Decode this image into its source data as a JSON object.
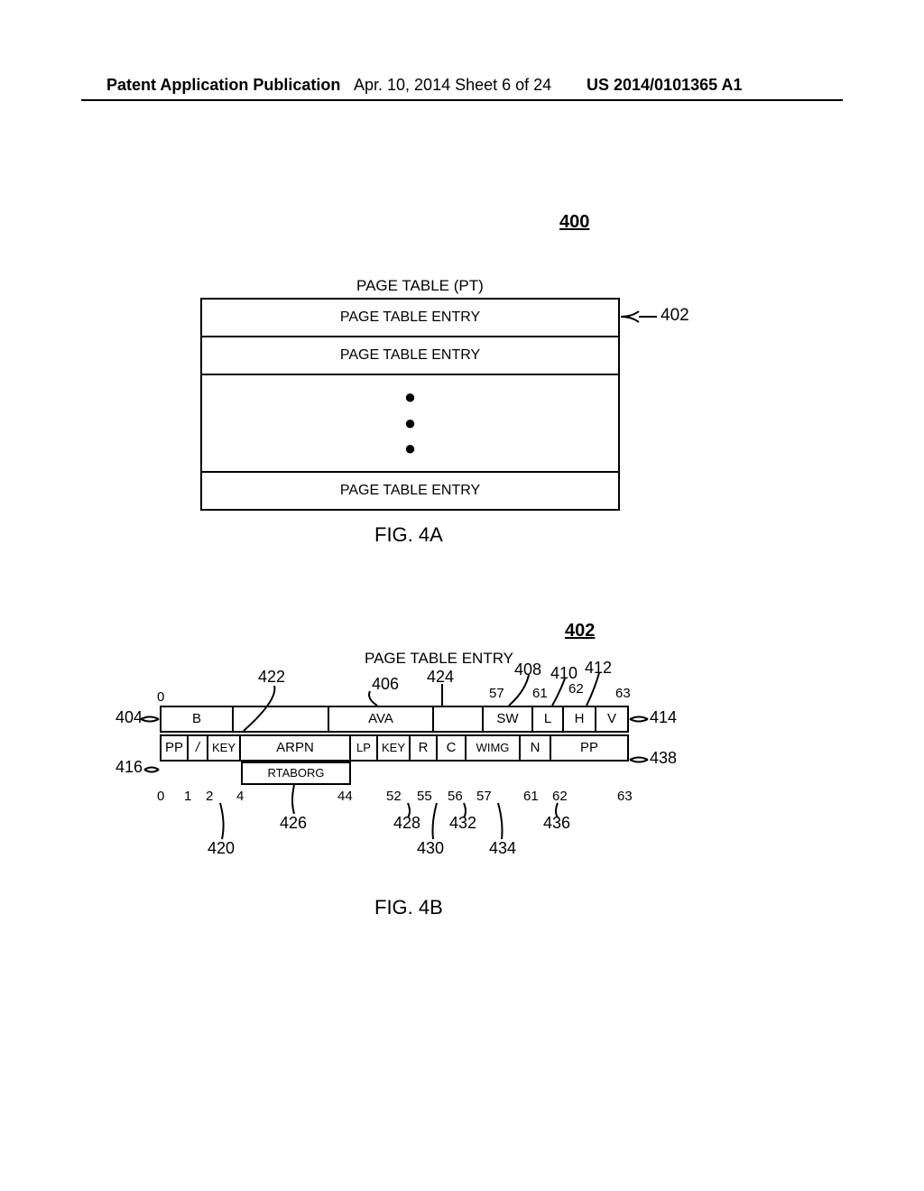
{
  "header": {
    "left": "Patent Application Publication",
    "mid": "Apr. 10, 2014  Sheet 6 of 24",
    "right": "US 2014/0101365 A1"
  },
  "fig4a": {
    "ref_400": "400",
    "title": "PAGE TABLE (PT)",
    "rows": [
      "PAGE TABLE ENTRY",
      "PAGE TABLE ENTRY",
      "PAGE TABLE ENTRY"
    ],
    "callout_402": "402",
    "caption": "FIG. 4A"
  },
  "fig4b": {
    "ref_402": "402",
    "title": "PAGE TABLE ENTRY",
    "row1": {
      "b": "B",
      "ava": "AVA",
      "sw": "SW",
      "l": "L",
      "h": "H",
      "v": "V"
    },
    "row2": {
      "pp1": "PP",
      "slash": "/",
      "key1": "KEY",
      "arpn": "ARPN",
      "lp": "LP",
      "key2": "KEY",
      "r": "R",
      "c": "C",
      "wimg": "WIMG",
      "n": "N",
      "pp2": "PP"
    },
    "rtaborg": "RTABORG",
    "bits_top": {
      "b0": "0",
      "b57": "57",
      "b61": "61",
      "b62": "62",
      "b63": "63"
    },
    "bits_bot": {
      "b0": "0",
      "b1": "1",
      "b2": "2",
      "b4": "4",
      "b44": "44",
      "b52": "52",
      "b55": "55",
      "b56": "56",
      "b57": "57",
      "b61": "61",
      "b62": "62",
      "b63": "63"
    },
    "refs": {
      "r404": "404",
      "r406": "406",
      "r408": "408",
      "r410": "410",
      "r412": "412",
      "r414": "414",
      "r416": "416",
      "r420": "420",
      "r422": "422",
      "r424": "424",
      "r426": "426",
      "r428": "428",
      "r430": "430",
      "r432": "432",
      "r434": "434",
      "r436": "436",
      "r438": "438"
    },
    "caption": "FIG. 4B"
  }
}
